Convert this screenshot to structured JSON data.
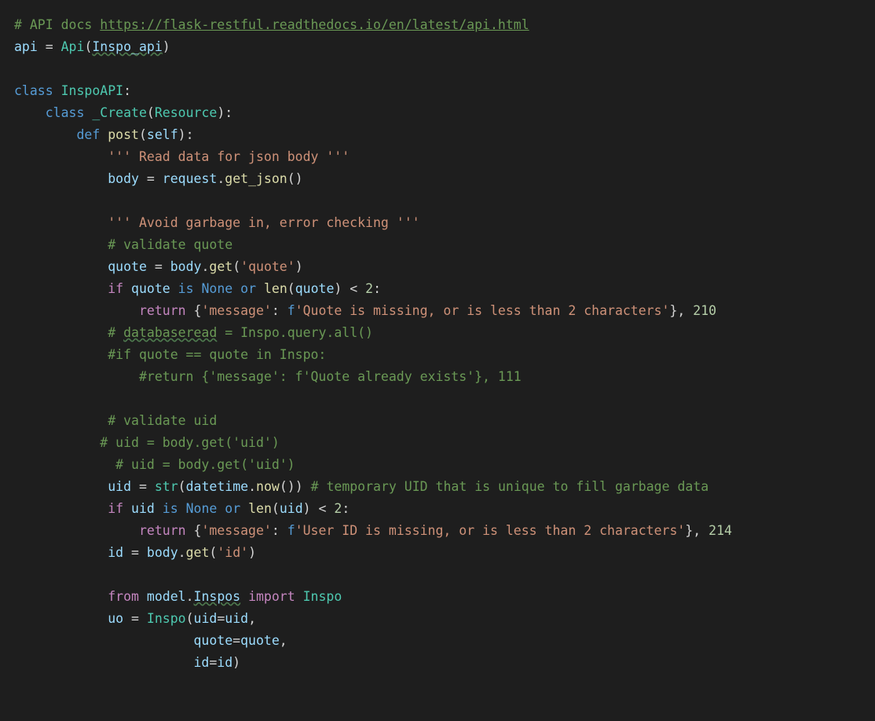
{
  "lines": {
    "l1_comment": "# API docs ",
    "l1_url": "https://flask-restful.readthedocs.io/en/latest/api.html",
    "l2_api": "api",
    "l2_eq": " = ",
    "l2_Api": "Api",
    "l2_arg": "Inspo_api",
    "l4_class": "class",
    "l4_name": "InspoAPI",
    "l5_class": "class",
    "l5_name": "_Create",
    "l5_base": "Resource",
    "l6_def": "def",
    "l6_name": "post",
    "l6_self": "self",
    "l7_doc": "''' Read data for json body '''",
    "l8_body": "body",
    "l8_req": "request",
    "l8_get": "get_json",
    "l10_doc": "''' Avoid garbage in, error checking '''",
    "l11_cmt": "# validate quote",
    "l12_quote": "quote",
    "l12_body": "body",
    "l12_get": "get",
    "l12_arg": "'quote'",
    "l13_if": "if",
    "l13_quote": "quote",
    "l13_is": "is",
    "l13_none": "None",
    "l13_or": "or",
    "l13_len": "len",
    "l13_q2": "quote",
    "l13_lt": " < ",
    "l13_2": "2",
    "l14_return": "return",
    "l14_k": "'message'",
    "l14_f": "f",
    "l14_msg": "'Quote is missing, or is less than 2 characters'",
    "l14_code": "210",
    "l15_cmt_a": "# ",
    "l15_cmt_b": "databaseread",
    "l15_cmt_c": " = Inspo.query.all()",
    "l16_cmt": "#if quote == quote in Inspo:",
    "l17_cmt": "#return {'message': f'Quote already exists'}, 111",
    "l19_cmt": "# validate uid",
    "l20_cmt": "# uid = body.get('uid')",
    "l21_cmt": "# uid = body.get('uid')",
    "l22_uid": "uid",
    "l22_str": "str",
    "l22_dt": "datetime",
    "l22_now": "now",
    "l22_cmt": "# temporary UID that is unique to fill garbage data",
    "l23_if": "if",
    "l23_uid": "uid",
    "l23_is": "is",
    "l23_none": "None",
    "l23_or": "or",
    "l23_len": "len",
    "l23_u2": "uid",
    "l23_2": "2",
    "l24_return": "return",
    "l24_k": "'message'",
    "l24_f": "f",
    "l24_msg": "'User ID is missing, or is less than 2 characters'",
    "l24_code": "214",
    "l25_id": "id",
    "l25_body": "body",
    "l25_get": "get",
    "l25_arg": "'id'",
    "l27_from": "from",
    "l27_mod": "model",
    "l27_ins": "Inspos",
    "l27_import": "import",
    "l27_cls": "Inspo",
    "l28_uo": "uo",
    "l28_cls": "Inspo",
    "l28_uid": "uid",
    "l28_uidv": "uid",
    "l29_quote": "quote",
    "l29_quotev": "quote",
    "l30_id": "id",
    "l30_idv": "id"
  }
}
